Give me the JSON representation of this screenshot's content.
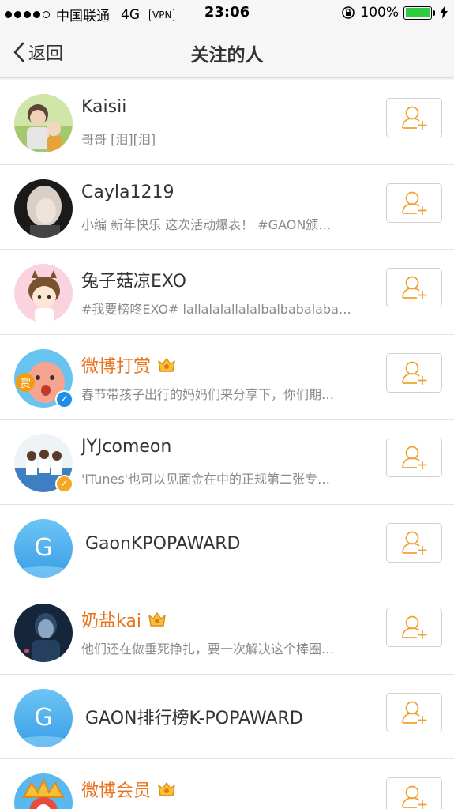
{
  "status_bar": {
    "carrier": "中国联通",
    "network": "4G",
    "vpn": "VPN",
    "time": "23:06",
    "battery": "100%",
    "battery_level": 1.0
  },
  "nav": {
    "back_label": "返回",
    "title": "关注的人"
  },
  "users": [
    {
      "name": "Kaisii",
      "desc": "哥哥 [泪][泪]",
      "name_color": "#333333",
      "crown": false,
      "verified": ""
    },
    {
      "name": "Cayla1219",
      "desc": "小编 新年快乐 这次活动爆表！ #GAON颁…",
      "name_color": "#333333",
      "crown": false,
      "verified": ""
    },
    {
      "name": "兔子菇凉EXO",
      "desc": "#我要榜咚EXO# lallalalallalalbalbabalaba…",
      "name_color": "#333333",
      "crown": false,
      "verified": ""
    },
    {
      "name": "微博打赏",
      "desc": "春节带孩子出行的妈妈们来分享下，你们期…",
      "name_color": "#e9731c",
      "crown": true,
      "verified": "blue"
    },
    {
      "name": "JYJcomeon",
      "desc": "'iTunes'也可以见面金在中的正规第二张专…",
      "name_color": "#333333",
      "crown": false,
      "verified": "orange"
    },
    {
      "name": "GaonKPOPAWARD",
      "desc": "",
      "name_color": "#333333",
      "crown": false,
      "verified": "",
      "avatar_letter": "G"
    },
    {
      "name": "奶盐kai",
      "desc": "他们还在做垂死挣扎，要一次解决这个棒圈…",
      "name_color": "#e9731c",
      "crown": true,
      "verified": ""
    },
    {
      "name": "GAON排行榜K-POPAWARD",
      "desc": "",
      "name_color": "#333333",
      "crown": false,
      "verified": "",
      "avatar_letter": "G"
    },
    {
      "name": "微博会员",
      "desc": "",
      "name_color": "#e9731c",
      "crown": true,
      "verified": ""
    }
  ],
  "colors": {
    "accent": "#e9731c",
    "verified_blue": "#1e8ee6",
    "verified_orange": "#f5a623",
    "battery_green": "#2ecc40"
  },
  "icons": {
    "follow": "add-user-icon",
    "back": "chevron-left-icon",
    "crown": "crown-icon"
  }
}
